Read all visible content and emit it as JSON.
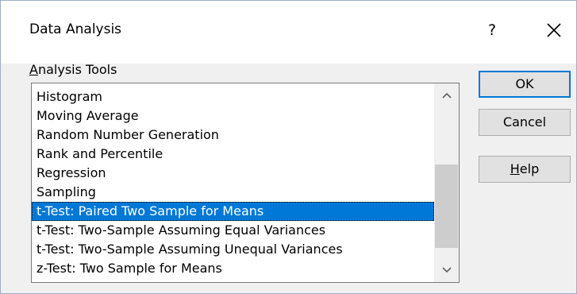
{
  "dialog": {
    "title": "Data Analysis",
    "help_glyph": "?",
    "close_icon": "close-icon"
  },
  "analysis_tools": {
    "label_first": "A",
    "label_rest": "nalysis Tools",
    "items": [
      "Histogram",
      "Moving Average",
      "Random Number Generation",
      "Rank and Percentile",
      "Regression",
      "Sampling",
      "t-Test: Paired Two Sample for Means",
      "t-Test: Two-Sample Assuming Equal Variances",
      "t-Test: Two-Sample Assuming Unequal Variances",
      "z-Test: Two Sample for Means"
    ],
    "selected": "t-Test: Paired Two Sample for Means",
    "scroll_position": 0.85,
    "visible_fraction": 0.55
  },
  "buttons": {
    "ok": "OK",
    "cancel": "Cancel",
    "help_first": "H",
    "help_rest": "elp"
  },
  "colors": {
    "selection": "#0078d7",
    "default_button_border": "#0078d7"
  }
}
